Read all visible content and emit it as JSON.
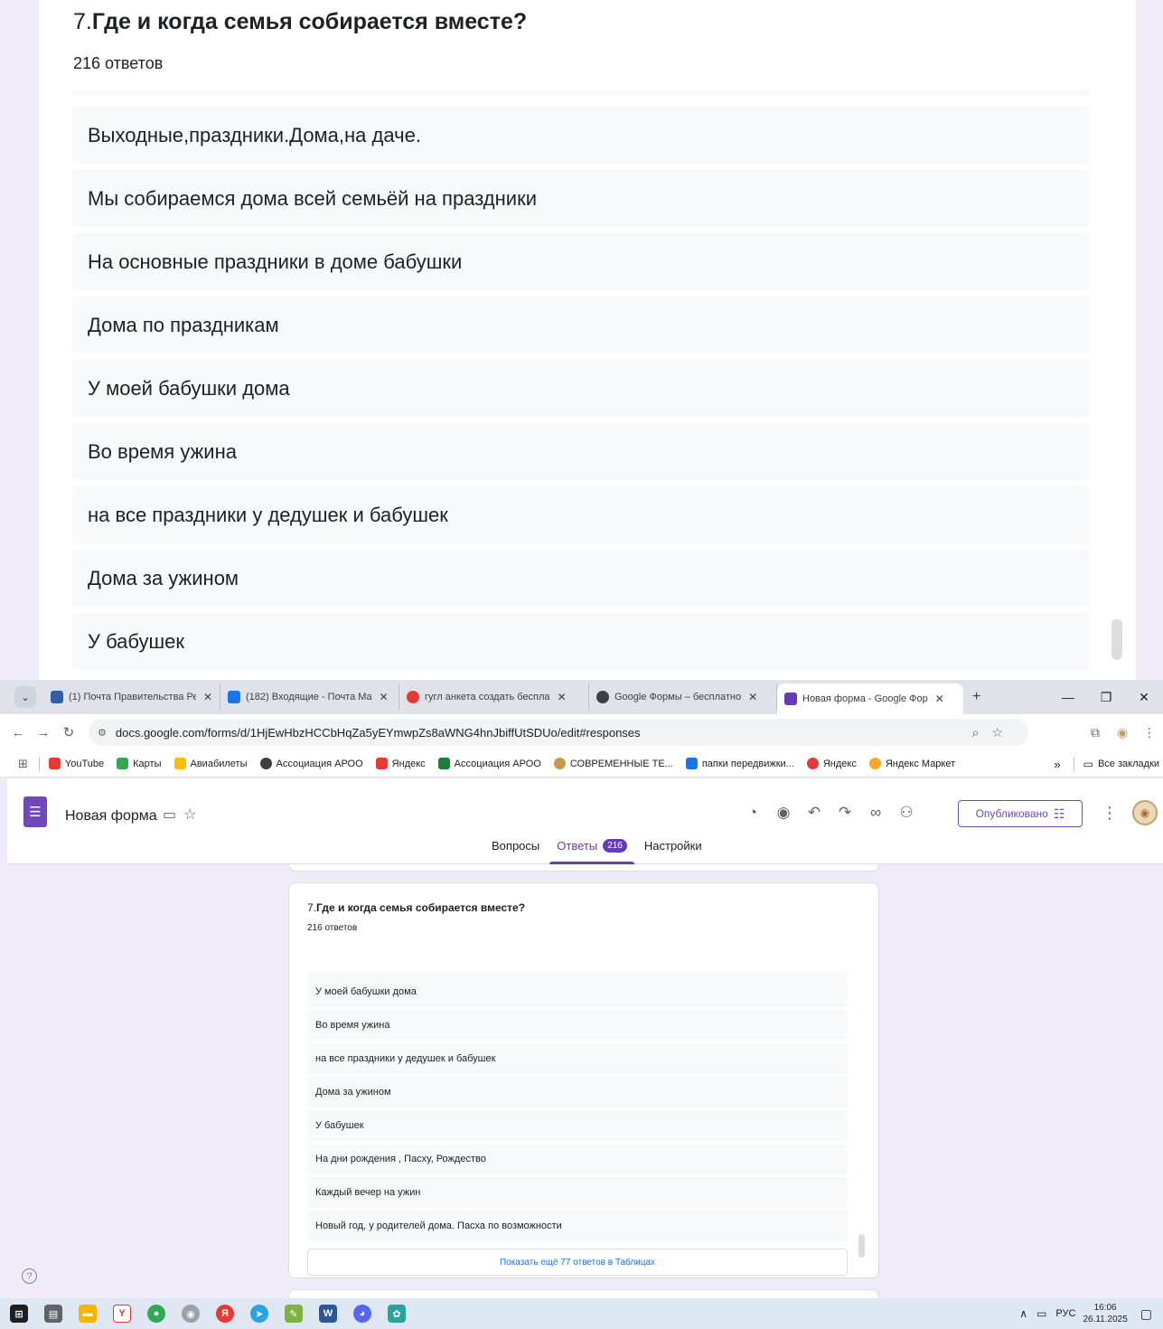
{
  "question": {
    "number": "7.",
    "title": "Где и когда семья собирается вместе?",
    "count": "216 ответов"
  },
  "zoom_answers": [
    "Выходные,праздники.Дома,на даче.",
    "Мы собираемся дома всей семьёй на праздники",
    "На основные праздники в доме бабушки",
    "Дома по праздникам",
    "У моей бабушки дома",
    "Во время ужина",
    "на все праздники у дедушек и бабушек",
    "Дома за ужином",
    "У бабушек"
  ],
  "card_answers": [
    "У моей бабушки дома",
    "Во время ужина",
    "на все праздники у дедушек и бабушек",
    "Дома за ужином",
    "У бабушек",
    "На дни рождения , Пасху, Рождество",
    "Каждый вечер на ужин",
    "Новый год, у родителей дома. Пасха по возможности"
  ],
  "show_more": "Показать ещё 77 ответов в Таблицах",
  "browser": {
    "tabs": [
      {
        "label": "(1) Почта Правительства Ре",
        "color": "#2f5fa7"
      },
      {
        "label": "(182) Входящие - Почта Ма",
        "color": "#1a73e8"
      },
      {
        "label": "гугл анкета создать беспла",
        "color": "#e53935"
      },
      {
        "label": "Google Формы – бесплатно",
        "color": "#3c4043"
      },
      {
        "label": "Новая форма - Google Фор",
        "color": "#673ab7"
      }
    ],
    "url": "docs.google.com/forms/d/1HjEwHbzHCCbHqZa5yEYmwpZs8aWNG4hnJbiffUtSDUo/edit#responses",
    "bookmarks": [
      {
        "label": "YouTube",
        "color": "#e53935"
      },
      {
        "label": "Карты",
        "color": "#34a853"
      },
      {
        "label": "Авиабилеты",
        "color": "#fbbc04"
      },
      {
        "label": "Ассоциация АРОО",
        "color": "#3c4043"
      },
      {
        "label": "Яндекс",
        "color": "#e53935"
      },
      {
        "label": "Ассоциация АРОО",
        "color": "#188038"
      },
      {
        "label": "СОВРЕМЕННЫЕ ТЕ...",
        "color": "#c49a48"
      },
      {
        "label": "папки передвижки...",
        "color": "#1a73e8"
      },
      {
        "label": "Яндекс",
        "color": "#e53935"
      },
      {
        "label": "Яндекс Маркет",
        "color": "#f9a825"
      }
    ],
    "overflow": "»",
    "all_bookmarks": "Все закладки"
  },
  "form": {
    "title": "Новая форма",
    "published": "Опубликовано",
    "tabs": {
      "questions": "Вопросы",
      "responses": "Ответы",
      "responses_count": "216",
      "settings": "Настройки"
    }
  },
  "taskbar": {
    "lang": "РУС",
    "time": "16:06",
    "date": "26.11.2025"
  }
}
